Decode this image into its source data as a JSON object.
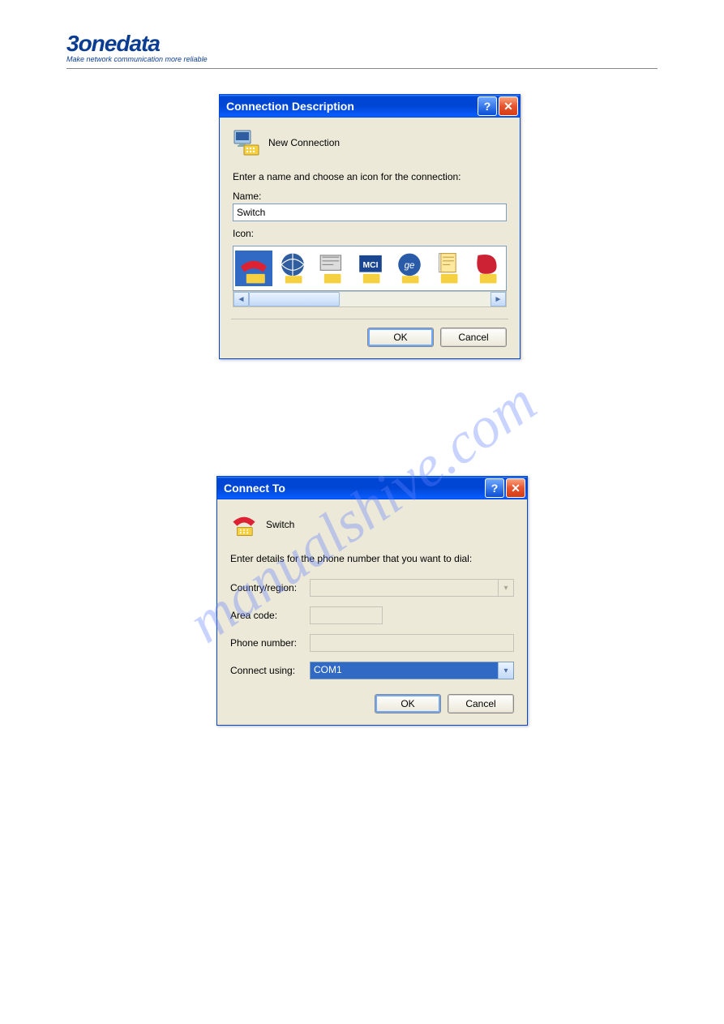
{
  "header": {
    "logo": "3onedata",
    "tagline": "Make network communication more reliable"
  },
  "watermark": "manualshive.com",
  "dialog1": {
    "title": "Connection Description",
    "subtitle": "New Connection",
    "prompt": "Enter a name and choose an icon for the connection:",
    "name_label": "Name:",
    "name_value": "Switch",
    "icon_label": "Icon:",
    "icons": [
      "phone-modem-icon",
      "globe-icon",
      "fax-icon",
      "mci-icon",
      "satellite-icon",
      "document-icon",
      "shape-icon"
    ],
    "ok": "OK",
    "cancel": "Cancel"
  },
  "dialog2": {
    "title": "Connect To",
    "subtitle": "Switch",
    "prompt": "Enter details for the phone number that you want to dial:",
    "country_label": "Country/region:",
    "country_value": "",
    "area_label": "Area code:",
    "area_value": "",
    "phone_label": "Phone number:",
    "phone_value": "",
    "connect_label": "Connect using:",
    "connect_value": "COM1",
    "ok": "OK",
    "cancel": "Cancel"
  }
}
